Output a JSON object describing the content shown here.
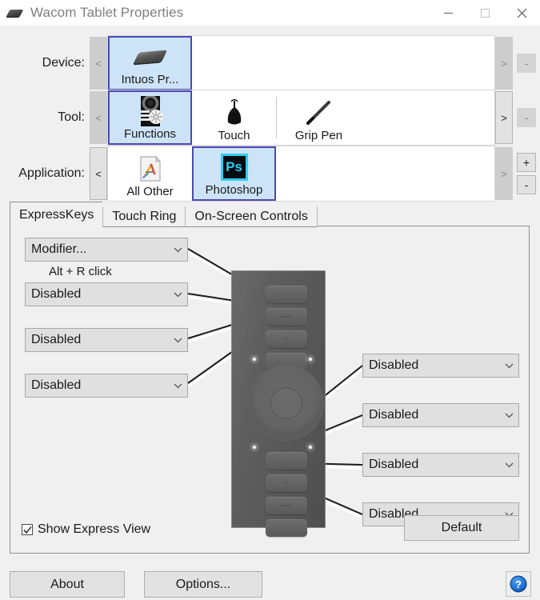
{
  "window": {
    "title": "Wacom Tablet Properties",
    "icon": "tablet-icon",
    "minimize_label": "—",
    "maximize_label": "□",
    "close_label": "✕"
  },
  "rows": [
    {
      "label": "Device:",
      "prev_label": "<",
      "next_label": ">",
      "items": [
        {
          "label": "Intuos  Pr...",
          "icon": "tablet-icon",
          "selected": true
        }
      ],
      "side_buttons": [
        {
          "label": "-",
          "name": "remove-device-button",
          "enabled": false
        }
      ]
    },
    {
      "label": "Tool:",
      "prev_label": "<",
      "next_label": ">",
      "items": [
        {
          "label": "Functions",
          "icon": "functions-icon",
          "selected": true
        },
        {
          "label": "Touch",
          "icon": "touch-icon",
          "selected": false
        },
        {
          "label": "Grip Pen",
          "icon": "grip-pen-icon",
          "selected": false
        }
      ],
      "side_buttons": [
        {
          "label": "-",
          "name": "remove-tool-button",
          "enabled": false
        }
      ]
    },
    {
      "label": "Application:",
      "prev_label": "<",
      "next_label": ">",
      "items": [
        {
          "label": "All Other",
          "icon": "all-other-icon",
          "selected": false
        },
        {
          "label": "Photoshop",
          "icon": "photoshop-icon",
          "selected": true
        }
      ],
      "side_buttons": [
        {
          "label": "+",
          "name": "add-application-button",
          "enabled": true
        },
        {
          "label": "-",
          "name": "remove-application-button",
          "enabled": true
        }
      ]
    }
  ],
  "tabs": [
    {
      "label": "ExpressKeys",
      "active": true
    },
    {
      "label": "Touch Ring",
      "active": false
    },
    {
      "label": "On-Screen Controls",
      "active": false
    }
  ],
  "expresskeys": {
    "left": [
      {
        "value": "Modifier...",
        "sub": "Alt + R click"
      },
      {
        "value": "Disabled",
        "sub": ""
      },
      {
        "value": "Disabled",
        "sub": ""
      },
      {
        "value": "Disabled",
        "sub": ""
      }
    ],
    "right": [
      {
        "value": "Disabled",
        "sub": ""
      },
      {
        "value": "Disabled",
        "sub": ""
      },
      {
        "value": "Disabled",
        "sub": ""
      },
      {
        "value": "Disabled",
        "sub": ""
      }
    ],
    "show_express_view": {
      "label": "Show Express View",
      "checked": true
    },
    "default_button": "Default"
  },
  "footer": {
    "about_label": "About",
    "options_label": "Options...",
    "help_label": "?"
  },
  "colors": {
    "selection_fill": "#cde3f7",
    "selection_border": "#4a4ab4",
    "photoshop_accent": "#2bcff2",
    "window_bg": "#f0f0f0",
    "tablet_body": "#5e5e5e",
    "help_blue": "#1a6fd4"
  }
}
